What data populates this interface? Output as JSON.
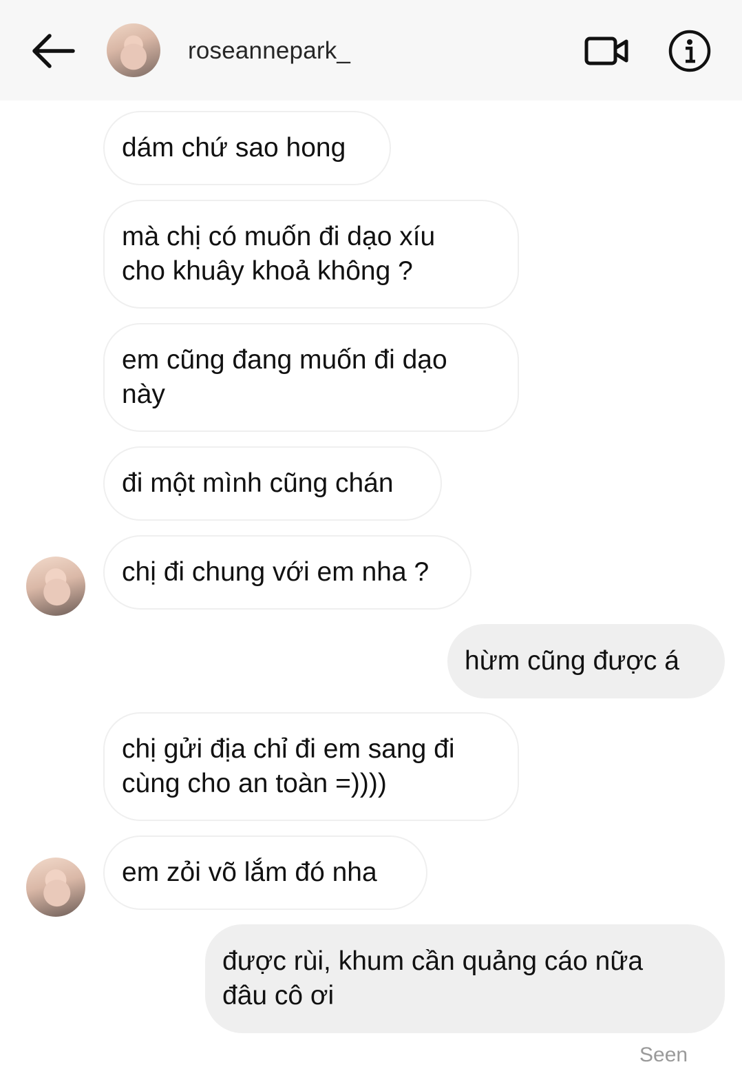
{
  "header": {
    "username": "roseannepark_",
    "back_icon": "arrow-left-icon",
    "video_icon": "video-camera-icon",
    "info_icon": "info-circle-icon"
  },
  "messages": [
    {
      "sender": "them",
      "text": "dám chứ sao hong"
    },
    {
      "sender": "them",
      "text": "mà chị có muốn đi dạo xíu\ncho khuây khoả không ?"
    },
    {
      "sender": "them",
      "text": "em cũng đang muốn đi dạo\nnày"
    },
    {
      "sender": "them",
      "text": "đi một mình cũng chán"
    },
    {
      "sender": "them",
      "text": "chị đi chung với em nha ?"
    },
    {
      "sender": "me",
      "text": "hừm cũng được á"
    },
    {
      "sender": "them",
      "text": "chị gửi địa chỉ đi em sang đi\ncùng cho an toàn =))))"
    },
    {
      "sender": "them",
      "text": "em zỏi võ lắm đó nha"
    },
    {
      "sender": "me",
      "text": "được rùi, khum cần quảng cáo nữa\nđâu cô ơi"
    }
  ],
  "status": {
    "seen": "Seen"
  },
  "colors": {
    "header_bg": "#f7f7f7",
    "incoming_border": "#efefef",
    "outgoing_bg": "#efefef",
    "seen_text": "#9a9a9a"
  }
}
